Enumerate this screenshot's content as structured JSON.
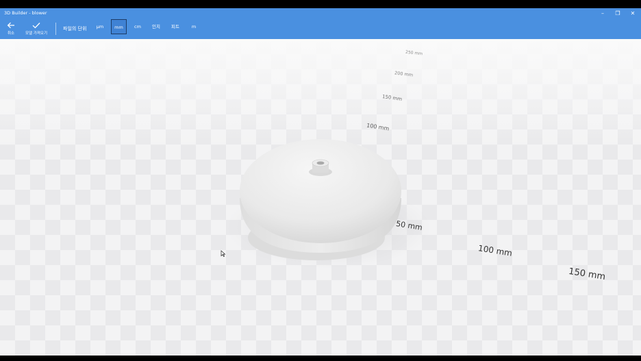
{
  "window": {
    "title": "3D Builder - blower",
    "minimize_glyph": "–",
    "restore_glyph": "❐",
    "close_glyph": "✕"
  },
  "toolbar": {
    "cancel": {
      "icon": "back-arrow-icon",
      "label": "취소"
    },
    "import": {
      "icon": "checkmark-icon",
      "label": "모델 가져오기"
    },
    "units_label": "파일의 단위",
    "units": [
      "µm",
      "mm",
      "cm",
      "인치",
      "피트",
      "m"
    ],
    "selected_unit": "mm"
  },
  "viewport": {
    "rulers": [
      "250 mm",
      "200 mm",
      "150 mm",
      "100 mm",
      "50 mm",
      "100 mm",
      "150 mm"
    ],
    "model_name": "blower"
  },
  "colors": {
    "accent": "#4a90e0",
    "floor": "#f3f3f4",
    "model": "#e8e8e8"
  }
}
